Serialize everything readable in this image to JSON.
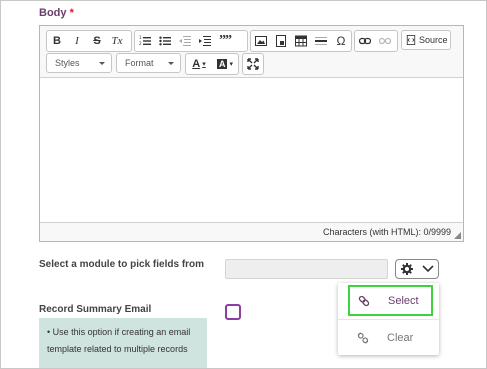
{
  "body_label": "Body",
  "required_mark": "*",
  "toolbar": {
    "bold": "B",
    "italic": "I",
    "strike": "S",
    "remove_format": "Tx",
    "blockquote": "99",
    "omega": "Ω",
    "source_label": "Source",
    "styles_label": "Styles",
    "format_label": "Format",
    "text_color": "A",
    "bg_color": "A"
  },
  "status_text": "Characters (with HTML): 0/9999",
  "module_label": "Select a module to pick fields from",
  "record_summary_label": "Record Summary Email",
  "hint_text": "• Use this option if creating an email template related to multiple records",
  "dropdown": {
    "select_label": "Select",
    "clear_label": "Clear"
  },
  "colors": {
    "label_purple": "#6b3d6b",
    "required_red": "#e5171f",
    "highlight_green": "#3fd23f",
    "hint_bg": "#cfe3df",
    "checkbox_purple": "#8b3fa0"
  }
}
